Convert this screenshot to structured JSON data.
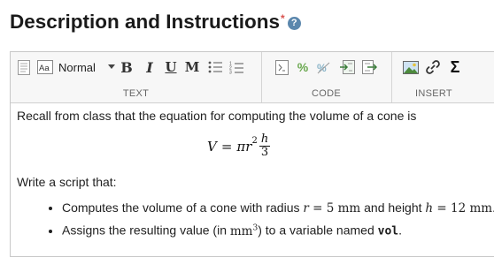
{
  "header": {
    "title": "Description and Instructions",
    "required_mark": "*",
    "help_glyph": "?"
  },
  "toolbar": {
    "text_group": {
      "label": "TEXT",
      "style_value": "Normal",
      "bold": "B",
      "italic": "I",
      "underline": "U",
      "monospace": "M"
    },
    "code_group": {
      "label": "CODE",
      "percent": "%"
    },
    "insert_group": {
      "label": "INSERT",
      "equation": "Σ"
    }
  },
  "content": {
    "intro": "Recall from class that the equation for computing the volume of a cone is",
    "formula": {
      "lhs": "V",
      "eq": "=",
      "pi": "π",
      "r": "r",
      "exp": "2",
      "num": "h",
      "den": "3"
    },
    "script_prompt": "Write a script that:",
    "bullet1": {
      "text_a": "Computes the volume of a cone with radius ",
      "var_r": "r",
      "val_r": " = 5 mm",
      "text_b": " and height ",
      "var_h": "h",
      "val_h": " = 12 mm",
      "end": "."
    },
    "bullet2": {
      "text_a": "Assigns the resulting value (in ",
      "unit": "mm",
      "unit_exp": "3",
      "text_b": ") to a variable named ",
      "varname": "vol",
      "end": "."
    }
  },
  "colors": {
    "help_icon": "#5b87ad",
    "required": "#d9534f",
    "toolbar_bg": "#f7f7f7",
    "border": "#c8c8c8"
  }
}
